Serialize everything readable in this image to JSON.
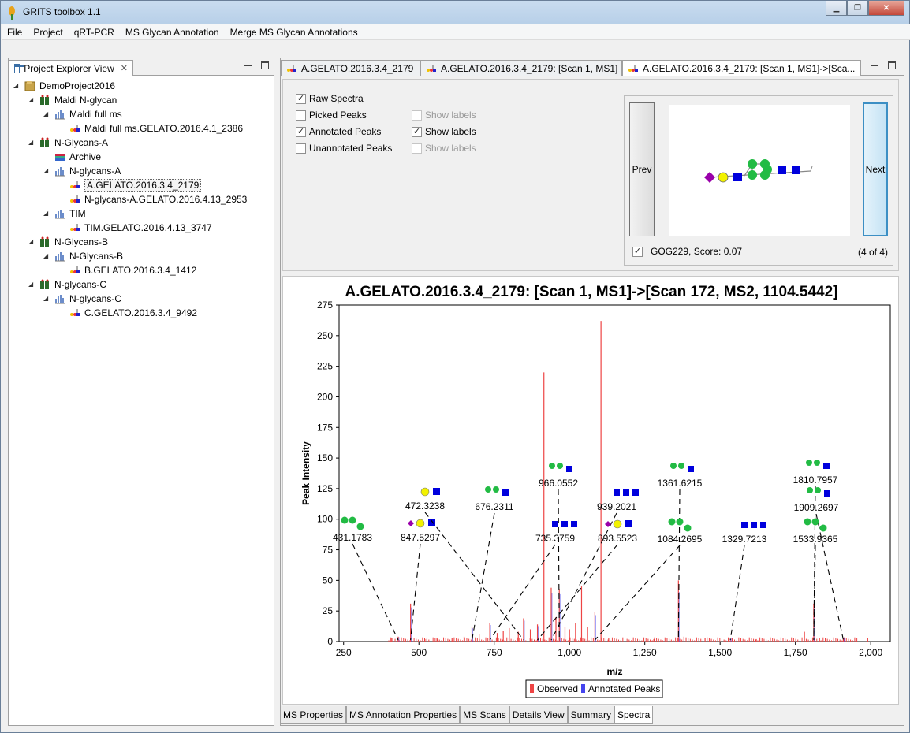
{
  "app": {
    "title": "GRITS toolbox 1.1"
  },
  "menu": [
    "File",
    "Project",
    "qRT-PCR",
    "MS Glycan Annotation",
    "Merge MS Glycan Annotations"
  ],
  "explorer": {
    "title": "Project Explorer View",
    "nodes": [
      "DemoProject2016",
      "Maldi N-glycan",
      "Maldi full ms",
      "Maldi full ms.GELATO.2016.4.1_2386",
      "N-Glycans-A",
      "Archive",
      "N-glycans-A",
      "A.GELATO.2016.3.4_2179",
      "N-glycans-A.GELATO.2016.4.13_2953",
      "TIM",
      "TIM.GELATO.2016.4.13_3747",
      "N-Glycans-B",
      "N-Glycans-B",
      "B.GELATO.2016.3.4_1412",
      "N-glycans-C",
      "N-glycans-C",
      "C.GELATO.2016.3.4_9492"
    ]
  },
  "editor_tabs": [
    "A.GELATO.2016.3.4_2179",
    "A.GELATO.2016.3.4_2179: [Scan 1, MS1]",
    "A.GELATO.2016.3.4_2179: [Scan 1, MS1]->[Sca..."
  ],
  "controls": {
    "raw_spectra": "Raw Spectra",
    "picked_peaks": "Picked Peaks",
    "annotated_peaks": "Annotated Peaks",
    "unannotated_peaks": "Unannotated Peaks",
    "show_labels": "Show labels",
    "prev": "Prev",
    "next": "Next",
    "glycan_info": "GOG229, Score: 0.07",
    "counter": "(4 of 4)"
  },
  "bottom_tabs": [
    "MS Properties",
    "MS Annotation Properties",
    "MS Scans",
    "Details View",
    "Summary",
    "Spectra"
  ],
  "colors": {
    "observed": "#ee4444",
    "annotated": "#4444ee",
    "gal": "#f2f200",
    "glc": "#22bb44",
    "glcnac": "#0000dd",
    "neuac": "#9900aa"
  },
  "chart_data": {
    "type": "line",
    "title": "A.GELATO.2016.3.4_2179: [Scan 1, MS1]->[Scan 172, MS2, 1104.5442]",
    "xlabel": "m/z",
    "ylabel": "Peak Intensity",
    "xlim": [
      235,
      2065
    ],
    "ylim": [
      0,
      275
    ],
    "xticks": [
      "250",
      "500",
      "750",
      "1,000",
      "1,250",
      "1,500",
      "1,750",
      "2,000"
    ],
    "yticks": [
      "0",
      "25",
      "50",
      "75",
      "100",
      "125",
      "150",
      "175",
      "200",
      "225",
      "250",
      "275"
    ],
    "legend": [
      "Observed",
      "Annotated Peaks"
    ],
    "legend_position": "bottom",
    "observed_peaks": [
      [
        410,
        3
      ],
      [
        431.2,
        4
      ],
      [
        472.3,
        31
      ],
      [
        520,
        2
      ],
      [
        560,
        3
      ],
      [
        610,
        3
      ],
      [
        650,
        4
      ],
      [
        676.2,
        12
      ],
      [
        700,
        6
      ],
      [
        735.4,
        15
      ],
      [
        760,
        7
      ],
      [
        780,
        9
      ],
      [
        800,
        11
      ],
      [
        830,
        8
      ],
      [
        847.5,
        19
      ],
      [
        870,
        10
      ],
      [
        893.6,
        14
      ],
      [
        915,
        220
      ],
      [
        939.2,
        44
      ],
      [
        955,
        20
      ],
      [
        966.1,
        43
      ],
      [
        985,
        12
      ],
      [
        1000,
        10
      ],
      [
        1020,
        15
      ],
      [
        1040,
        45
      ],
      [
        1060,
        12
      ],
      [
        1084.3,
        24
      ],
      [
        1104.5,
        262
      ],
      [
        1130,
        3
      ],
      [
        1280,
        2
      ],
      [
        1361.6,
        50
      ],
      [
        1380,
        4
      ],
      [
        1450,
        3
      ],
      [
        1540,
        3
      ],
      [
        1620,
        2
      ],
      [
        1780,
        8
      ],
      [
        1810.8,
        31
      ],
      [
        1830,
        3
      ],
      [
        1909.3,
        3
      ],
      [
        1990,
        3
      ]
    ],
    "annotated_peaks": [
      431.2,
      472.3,
      676.2,
      735.4,
      847.5,
      893.6,
      939.2,
      966.1,
      1084.3,
      1361.6,
      1533.9,
      1810.8,
      1909.3
    ],
    "annotations": [
      {
        "label": "431.1783",
        "peak_mz": 431.2
      },
      {
        "label": "847.5297",
        "peak_mz": 472.3
      },
      {
        "label": "472.3238",
        "peak_mz": 847.5
      },
      {
        "label": "676.2311",
        "peak_mz": 676.2
      },
      {
        "label": "966.0552",
        "peak_mz": 966.1
      },
      {
        "label": "735.3759",
        "peak_mz": 735.4
      },
      {
        "label": "939.2021",
        "peak_mz": 939.2
      },
      {
        "label": "893.5523",
        "peak_mz": 893.6
      },
      {
        "label": "1361.6215",
        "peak_mz": 1361.6
      },
      {
        "label": "1084.2695",
        "peak_mz": 1084.3
      },
      {
        "label": "1329.7213",
        "peak_mz": 1533.9
      },
      {
        "label": "1810.7957",
        "peak_mz": 1810.8
      },
      {
        "label": "1909.2697",
        "peak_mz": 1909.3
      },
      {
        "label": "1533.9365",
        "peak_mz": 1810.8
      }
    ]
  }
}
